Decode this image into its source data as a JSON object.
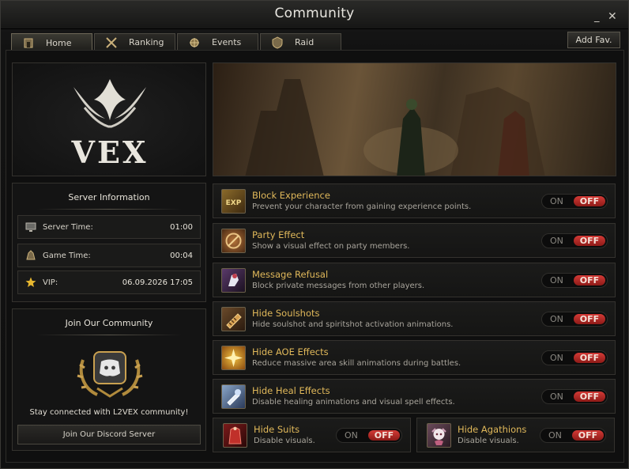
{
  "window": {
    "title": "Community",
    "minimize": "_",
    "close": "✕"
  },
  "tabs": [
    {
      "label": "Home",
      "icon": "home-icon"
    },
    {
      "label": "Ranking",
      "icon": "crossed-swords-icon"
    },
    {
      "label": "Events",
      "icon": "events-icon"
    },
    {
      "label": "Raid",
      "icon": "shield-icon"
    }
  ],
  "add_fav": "Add Fav.",
  "logo": {
    "text": "VEX"
  },
  "server_info": {
    "title": "Server Information",
    "rows": [
      {
        "label": "Server Time:",
        "value": "01:00",
        "icon": "monitor-icon"
      },
      {
        "label": "Game Time:",
        "value": "00:04",
        "icon": "helmet-icon"
      },
      {
        "label": "VIP:",
        "value": "06.09.2026 17:05",
        "icon": "star-icon"
      }
    ]
  },
  "community": {
    "title": "Join Our Community",
    "text": "Stay connected with L2VEX community!",
    "button": "Join Our Discord Server"
  },
  "options": [
    {
      "name": "Block Experience",
      "desc": "Prevent your character from gaining experience points.",
      "icon": "exp-icon",
      "on": "ON",
      "off": "OFF"
    },
    {
      "name": "Party Effect",
      "desc": "Show a visual effect on party members.",
      "icon": "party-effect-icon",
      "on": "ON",
      "off": "OFF"
    },
    {
      "name": "Message Refusal",
      "desc": "Block private messages from other players.",
      "icon": "message-refusal-icon",
      "on": "ON",
      "off": "OFF"
    },
    {
      "name": "Hide Soulshots",
      "desc": "Hide soulshot and spiritshot activation animations.",
      "icon": "soulshot-icon",
      "on": "ON",
      "off": "OFF"
    },
    {
      "name": "Hide AOE Effects",
      "desc": "Reduce massive area skill animations during battles.",
      "icon": "aoe-icon",
      "on": "ON",
      "off": "OFF"
    },
    {
      "name": "Hide Heal Effects",
      "desc": "Disable healing animations and visual spell effects.",
      "icon": "heal-icon",
      "on": "ON",
      "off": "OFF"
    },
    {
      "name": "Hide Suits",
      "desc": "Disable visuals.",
      "icon": "suit-icon",
      "on": "ON",
      "off": "OFF"
    },
    {
      "name": "Hide Agathions",
      "desc": "Disable visuals.",
      "icon": "agathion-icon",
      "on": "ON",
      "off": "OFF"
    }
  ]
}
